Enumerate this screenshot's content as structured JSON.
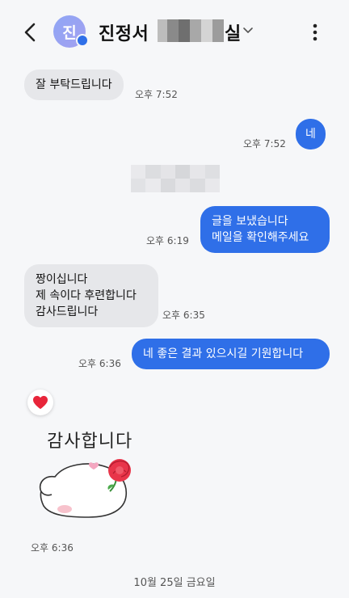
{
  "header": {
    "avatar_initial": "진",
    "contact_name": "진정서",
    "contact_name_suffix": "실",
    "back_icon": "chevron-left",
    "expand_icon": "chevron-down",
    "more_icon": "more-vertical"
  },
  "messages": [
    {
      "direction": "in",
      "text": "잘 부탁드립니다",
      "time": "오후 7:52"
    },
    {
      "direction": "out",
      "text": "네",
      "time": "오후 7:52"
    },
    {
      "direction": "out",
      "text": "글을 보냈습니다\n메일을 확인해주세요",
      "time": "오후 6:19"
    },
    {
      "direction": "in",
      "text": "짱이십니다\n제 속이다 후련합니다\n감사드립니다",
      "time": "오후 6:35"
    },
    {
      "direction": "out",
      "text": "네 좋은 결과 있으시길 기원합니다",
      "time": "오후 6:36"
    }
  ],
  "sticker": {
    "reaction": "heart",
    "text": "감사합니다",
    "time": "오후 6:36"
  },
  "date_divider": "10월 25일 금요일",
  "colors": {
    "background": "#f6f7f9",
    "incoming_bubble": "#e6e7ea",
    "outgoing_bubble": "#2f6fe8",
    "heart": "#e8253a"
  }
}
